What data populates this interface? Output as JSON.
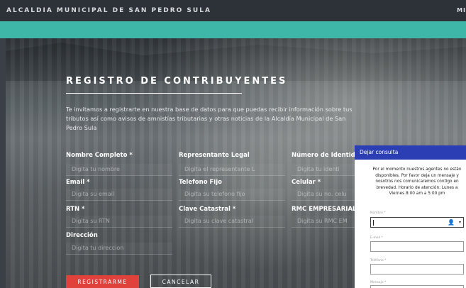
{
  "header": {
    "brand": "ALCALDIA MUNICIPAL DE SAN PEDRO SULA",
    "menu_fragment": "MI"
  },
  "page": {
    "title": "REGISTRO DE CONTRIBUYENTES",
    "intro": "Te invitamos a registrarte en nuestra base de datos para que puedas recibir información sobre tus tributos así como avisos de amnistías tributarias y otras noticias de la Alcaldía Municipal de San Pedro Sula"
  },
  "form": {
    "nombre": {
      "label": "Nombre Completo *",
      "placeholder": "Digita tu nombre"
    },
    "representante": {
      "label": "Representante Legal",
      "placeholder": "Digita el representante L"
    },
    "identidad": {
      "label": "Número de Identid",
      "placeholder": "Digita tu identi"
    },
    "email": {
      "label": "Email *",
      "placeholder": "Digita su email"
    },
    "telefono": {
      "label": "Telefono Fijo",
      "placeholder": "Digita su telefono fijo"
    },
    "celular": {
      "label": "Celular *",
      "placeholder": "Digita su no. celu"
    },
    "rtn": {
      "label": "RTN *",
      "placeholder": "Digita su RTN"
    },
    "clave": {
      "label": "Clave Catastral *",
      "placeholder": "Digita su clave catastral"
    },
    "rmc": {
      "label": "RMC EMPRESARIAL",
      "placeholder": "Digita su RMC EM"
    },
    "direccion": {
      "label": "Dirección",
      "placeholder": "Digita tu direccion"
    },
    "submit_label": "REGISTRARME",
    "cancel_label": "CANCELAR"
  },
  "chat": {
    "title": "Dejar consulta",
    "message": "Por el momento nuestros agentes no están disponibles. Por favor deja un mensaje y nosotros nos comunicaremos contigo en brevedad. Horario de atención: Lunes a Viernes 8:00 am a 5:00 pm",
    "name_label": "Nombre *",
    "email_label": "E-mail *",
    "phone_label": "Teléfono *",
    "message_label": "Mensaje *",
    "icons": [
      "person-icon",
      "chevron-down-icon"
    ]
  },
  "colors": {
    "topbar": "#2c3238",
    "accent": "#3eb6a8",
    "register_button": "#e0413a",
    "chat_header": "#2b3eb3"
  }
}
